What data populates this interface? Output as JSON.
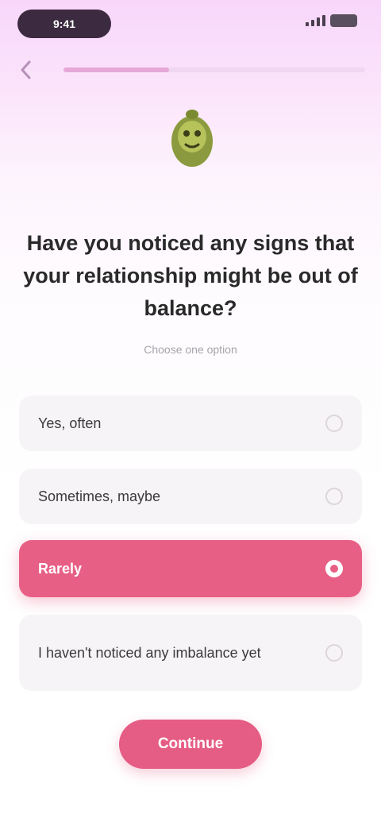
{
  "status_bar": {
    "time": "9:41",
    "center_text": "",
    "signal_level": 0.75
  },
  "nav": {
    "back_icon": "arrow-left-icon",
    "progress": 0.35
  },
  "mascot": {
    "icon": "mascot-icon"
  },
  "question": {
    "title": "Have you noticed any signs that your relationship might be out of balance?",
    "hint": "Choose one option"
  },
  "options": [
    {
      "label": "Yes, often",
      "selected": false
    },
    {
      "label": "Sometimes, maybe",
      "selected": false
    },
    {
      "label": "Rarely",
      "selected": true
    },
    {
      "label": "I haven't noticed any imbalance yet",
      "selected": false
    }
  ],
  "continue_button": {
    "label": "Continue"
  },
  "colors": {
    "accent": "#e85f86",
    "background_top": "#f8d6fb",
    "option_bg": "#f7f4f7"
  }
}
